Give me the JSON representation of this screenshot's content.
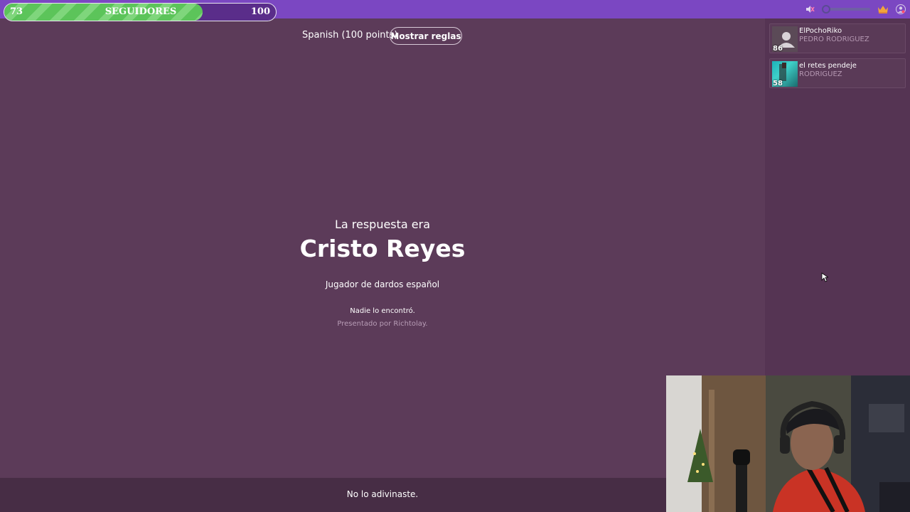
{
  "follower_goal": {
    "current": "73",
    "label": "SEGUIDORES",
    "goal": "100",
    "progress": 0.73
  },
  "header": {
    "mode": "Spanish (100 points)",
    "rules_button": "Mostrar reglas"
  },
  "answer": {
    "intro": "La respuesta era",
    "title": "Cristo Reyes",
    "description": "Jugador de dardos español",
    "result": "Nadie lo encontró.",
    "presented_by": "Presentado por Richtolay."
  },
  "players": [
    {
      "score": "86",
      "name": "ElPochoRiko",
      "answer": "PEDRO RODRIGUEZ"
    },
    {
      "score": "58",
      "name": "el retes pendeje",
      "answer": "RODRIGUEZ"
    }
  ],
  "bottom": {
    "message": "No lo adivinaste."
  },
  "icons": {
    "mute": "mute-icon",
    "crown": "crown-icon",
    "user": "user-icon"
  },
  "colors": {
    "background": "#5c3b59",
    "topbar": "#7b47c2",
    "progress_fill": "#5cc45a"
  }
}
